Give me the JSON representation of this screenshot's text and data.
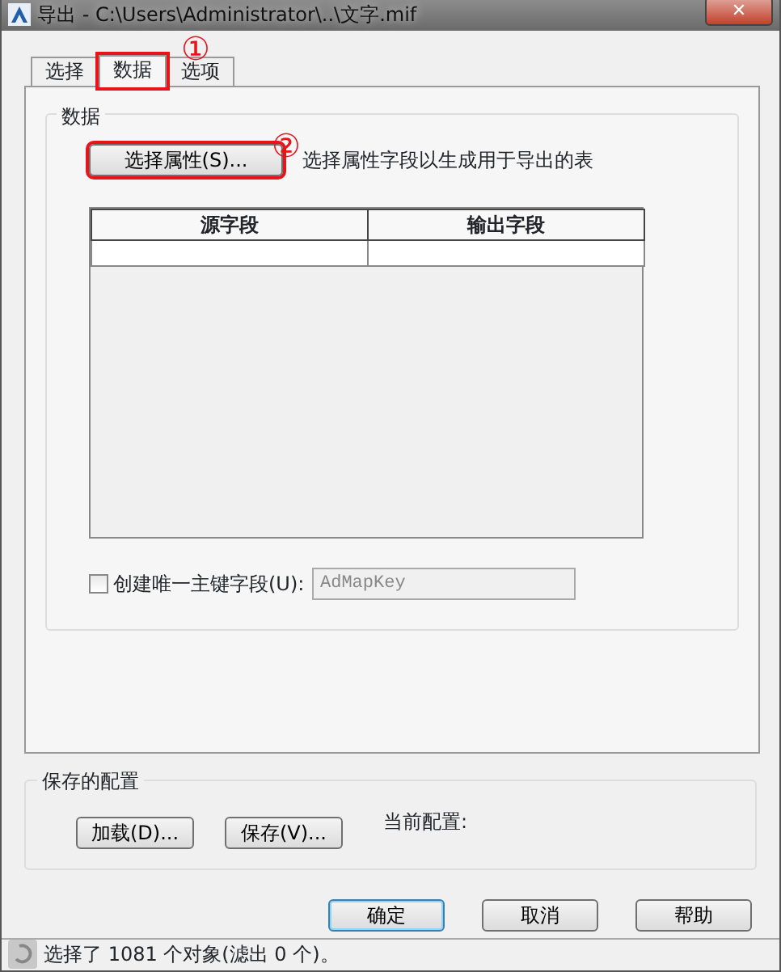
{
  "window": {
    "title": "导出 - C:\\Users\\Administrator\\..\\文字.mif",
    "close": "✕"
  },
  "tabs": [
    {
      "label": "选择",
      "selected": false,
      "highlighted": false
    },
    {
      "label": "数据",
      "selected": true,
      "highlighted": true
    },
    {
      "label": "选项",
      "selected": false,
      "highlighted": false
    }
  ],
  "annotations": [
    "①",
    "②"
  ],
  "data_group": {
    "title": "数据",
    "select_button": {
      "label": "选择属性(S)...",
      "highlighted": true
    },
    "hint": "选择属性字段以生成用于导出的表",
    "table": {
      "columns": [
        "源字段",
        "输出字段"
      ]
    },
    "key_checkbox": {
      "label": "创建唯一主键字段(U):",
      "checked": false
    },
    "key_field": {
      "value": "AdMapKey",
      "disabled": true
    }
  },
  "saved_config": {
    "title": "保存的配置",
    "buttons": [
      "加载(D)...",
      "保存(V)..."
    ],
    "current_label": "当前配置:"
  },
  "buttons": [
    {
      "label": "确定",
      "default": true
    },
    {
      "label": "取消",
      "default": false
    },
    {
      "label": "帮助",
      "default": false
    }
  ],
  "status_bar": "选择了 1081 个对象(滤出 0 个)。"
}
